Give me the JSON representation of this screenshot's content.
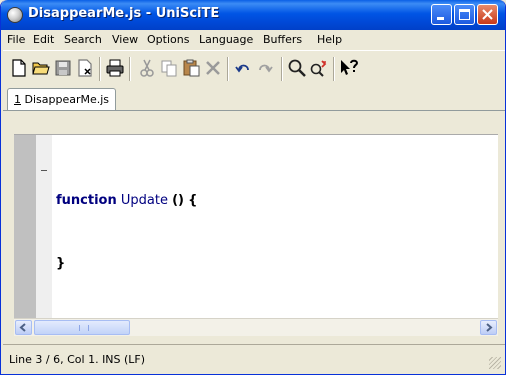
{
  "window": {
    "title": "DisappearMe.js - UniSciTE"
  },
  "menu": [
    "File",
    "Edit",
    "Search",
    "View",
    "Options",
    "Language",
    "Buffers",
    "Help"
  ],
  "toolbar": {
    "icons": [
      "new-file-icon",
      "open-folder-icon",
      "save-icon",
      "close-file-icon",
      "print-icon",
      "cut-icon",
      "copy-icon",
      "paste-icon",
      "delete-icon",
      "undo-icon",
      "redo-icon",
      "find-icon",
      "replace-icon",
      "help-icon"
    ]
  },
  "tabs": [
    {
      "number": "1",
      "name": "DisappearMe.js"
    }
  ],
  "editor": {
    "line1": {
      "keyword": "function",
      "identifier": "Update",
      "parens": "()",
      "brace": "{"
    },
    "line2": {
      "brace": "}"
    },
    "colors": {
      "keyword": "#00007F",
      "identifier": "#000080"
    }
  },
  "status": {
    "text": "Line 3 / 6, Col 1. INS (LF)"
  },
  "colors": {
    "titlebar": "#0055E5",
    "chrome": "#ECE9D8",
    "close": "#C8391A"
  }
}
